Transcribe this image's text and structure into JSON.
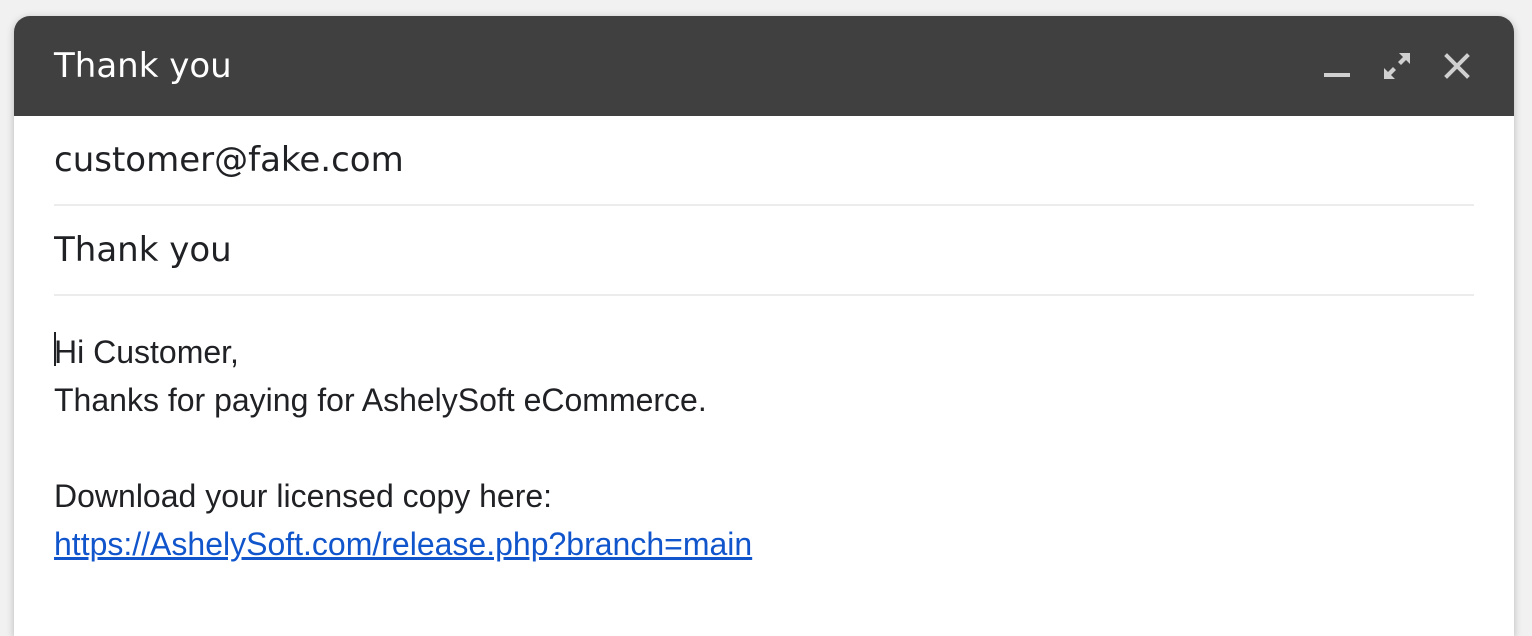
{
  "window": {
    "title": "Thank you",
    "controls": {
      "minimize_icon": "minimize-icon",
      "expand_icon": "expand-icon",
      "close_icon": "close-icon"
    },
    "titlebar_color": "#404040"
  },
  "compose": {
    "to_value": "customer@fake.com",
    "subject_value": "Thank you",
    "body": {
      "greeting": "Hi Customer,",
      "thanks": "Thanks for paying for AshelySoft eCommerce.",
      "download_text": "Download your licensed copy here:",
      "link_text": "https://AshelySoft.com/release.php?branch=main"
    },
    "link_color": "#1155cc"
  }
}
